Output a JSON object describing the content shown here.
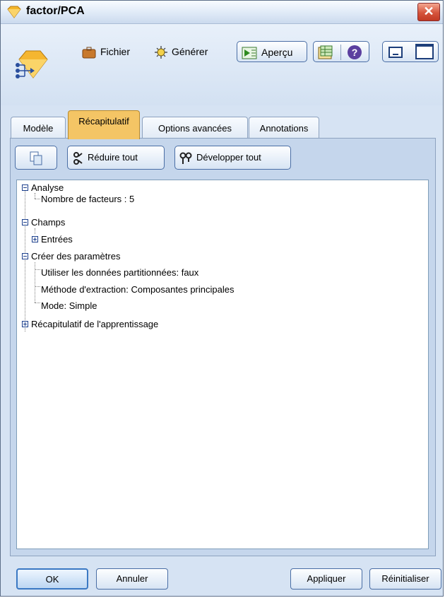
{
  "window": {
    "title": "factor/PCA",
    "close_glyph": "✕"
  },
  "toolbar": {
    "file_label": "Fichier",
    "file_mnemonic": "F",
    "generate_label": "Générer",
    "preview_label": "Aperçu",
    "help_glyph": "?"
  },
  "tabs": [
    {
      "label": "Modèle"
    },
    {
      "label": "Récapitulatif"
    },
    {
      "label": "Options avancées"
    },
    {
      "label": "Annotations"
    }
  ],
  "summary_toolbar": {
    "collapse_all": "Réduire tout",
    "expand_all": "Développer tout"
  },
  "tree": {
    "analysis": "Analyse",
    "num_factors": "Nombre de facteurs : 5",
    "fields": "Champs",
    "inputs": "Entrées",
    "build_settings": "Créer des paramètres",
    "partitioned": "Utiliser les données partitionnées: faux",
    "extraction": "Méthode d'extraction: Composantes principales",
    "mode": "Mode: Simple",
    "training_summary": "Récapitulatif de l'apprentissage"
  },
  "buttons": {
    "ok": "OK",
    "cancel": "Annuler",
    "apply": "Appliquer",
    "reset": "Réinitialiser"
  },
  "icons": {
    "title": "diamond-node-icon",
    "file": "briefcase-icon",
    "generate": "starburst-icon",
    "preview": "play-table-icon",
    "help": "help-icon"
  },
  "colors": {
    "active_tab": "#f4c565",
    "tree_connector": "#1c3f8c",
    "close": "#d5533c"
  }
}
